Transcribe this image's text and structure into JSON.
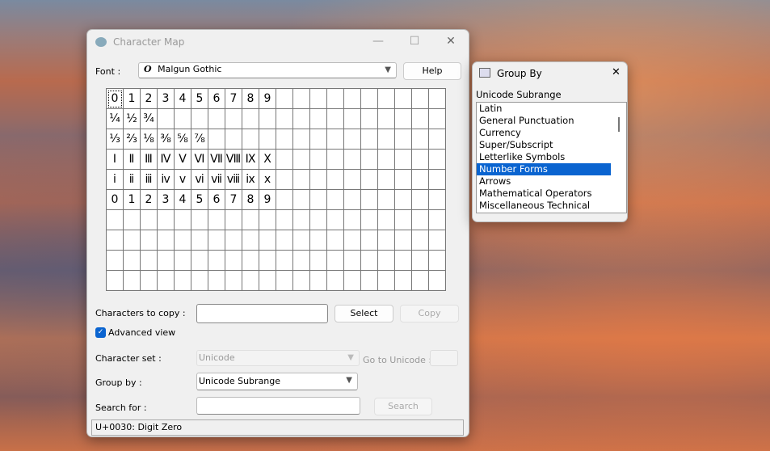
{
  "window": {
    "title": "Character Map",
    "minimize": "—",
    "maximize": "☐",
    "close": "✕"
  },
  "font": {
    "label": "Font :",
    "value": "Malgun Gothic",
    "icon": "O"
  },
  "help_label": "Help",
  "grid": [
    [
      "0",
      "1",
      "2",
      "3",
      "4",
      "5",
      "6",
      "7",
      "8",
      "9"
    ],
    [
      "¼",
      "½",
      "¾"
    ],
    [
      "⅓",
      "⅔",
      "⅛",
      "⅜",
      "⅝",
      "⅞"
    ],
    [
      "Ⅰ",
      "Ⅱ",
      "Ⅲ",
      "Ⅳ",
      "Ⅴ",
      "Ⅵ",
      "Ⅶ",
      "Ⅷ",
      "Ⅸ",
      "Ⅹ"
    ],
    [
      "ⅰ",
      "ⅱ",
      "ⅲ",
      "ⅳ",
      "ⅴ",
      "ⅵ",
      "ⅶ",
      "ⅷ",
      "ⅸ",
      "ⅹ"
    ],
    [
      "0",
      "1",
      "2",
      "3",
      "4",
      "5",
      "6",
      "7",
      "8",
      "9"
    ]
  ],
  "chars_to_copy": {
    "label": "Characters to copy :",
    "value": ""
  },
  "select_label": "Select",
  "copy_label": "Copy",
  "advanced_view": {
    "label": "Advanced view",
    "checked": true
  },
  "character_set": {
    "label": "Character set :",
    "value": "Unicode"
  },
  "goto_unicode": {
    "label": "Go to Unicode :",
    "value": ""
  },
  "group_by": {
    "label": "Group by :",
    "value": "Unicode Subrange"
  },
  "search": {
    "label": "Search for :",
    "value": "",
    "button": "Search"
  },
  "status": "U+0030: Digit Zero",
  "group_dialog": {
    "title": "Group By",
    "close": "✕",
    "heading": "Unicode Subrange",
    "items": [
      "Latin",
      "General Punctuation",
      "Currency",
      "Super/Subscript",
      "Letterlike Symbols",
      "Number Forms",
      "Arrows",
      "Mathematical Operators",
      "Miscellaneous Technical"
    ],
    "selected": "Number Forms"
  },
  "colors": {
    "selection": "#0a64d0",
    "checkbox": "#0a64d0"
  }
}
